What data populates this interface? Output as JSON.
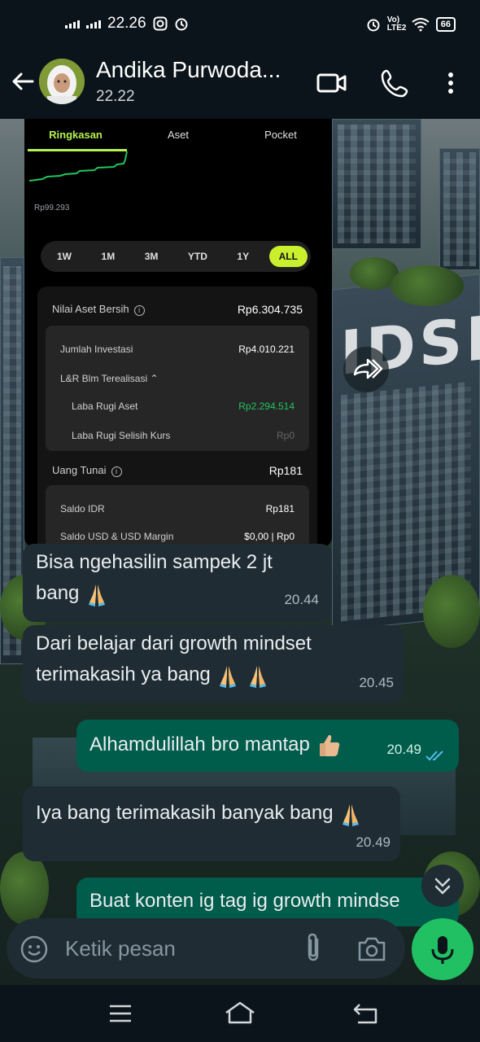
{
  "status_bar": {
    "time": "22.26",
    "network_label": "Vo) LTE2",
    "battery": "66"
  },
  "header": {
    "contact_name": "Andika Purwoda...",
    "subtitle": "22.22"
  },
  "forwarded_image": {
    "tabs": [
      "Ringkasan",
      "Aset",
      "Pocket"
    ],
    "active_tab": 0,
    "chart_low_label": "Rp99.293",
    "ranges": [
      "1W",
      "1M",
      "3M",
      "YTD",
      "1Y",
      "ALL"
    ],
    "active_range": 5,
    "net_asset_label": "Nilai Aset Bersih",
    "net_asset_value": "Rp6.304.735",
    "investment_label": "Jumlah Investasi",
    "investment_value": "Rp4.010.221",
    "unrealized_label": "L&R Blm Terealisasi",
    "asset_pl_label": "Laba Rugi Aset",
    "asset_pl_value": "Rp2.294.514",
    "fx_pl_label": "Laba Rugi Selisih Kurs",
    "fx_pl_value": "Rp0",
    "cash_label": "Uang Tunai",
    "cash_value": "Rp181",
    "idr_label": "Saldo IDR",
    "idr_value": "Rp181",
    "usd_label": "Saldo USD & USD Margin",
    "usd_value": "$0,00 | Rp0",
    "accent_color": "#b6f24f",
    "profit_color": "#22c55e"
  },
  "messages": [
    {
      "direction": "in",
      "text_line1": "Bisa ngehasilin sampek 2 jt",
      "text_line2": "bang",
      "emoji": "pray",
      "time": "20.44"
    },
    {
      "direction": "in",
      "text_line1": "Dari belajar dari growth mindset",
      "text_line2": "terimakasih ya bang",
      "emoji": "pray-pray",
      "time": "20.45"
    },
    {
      "direction": "out",
      "text": "Alhamdulillah bro mantap",
      "emoji": "thumbs-up",
      "time": "20.49",
      "status": "read"
    },
    {
      "direction": "in",
      "text": "Iya bang terimakasih banyak bang",
      "emoji": "pray",
      "time": "20.49"
    },
    {
      "direction": "out",
      "text": "Buat konten ig tag ig growth mindse"
    }
  ],
  "background_sign": "IDSET",
  "composer": {
    "placeholder": "Ketik pesan"
  },
  "colors": {
    "incoming_bubble": "#1f2c34",
    "outgoing_bubble": "#005c4b",
    "mic_button": "#21c063",
    "read_ticks": "#53bdeb"
  }
}
